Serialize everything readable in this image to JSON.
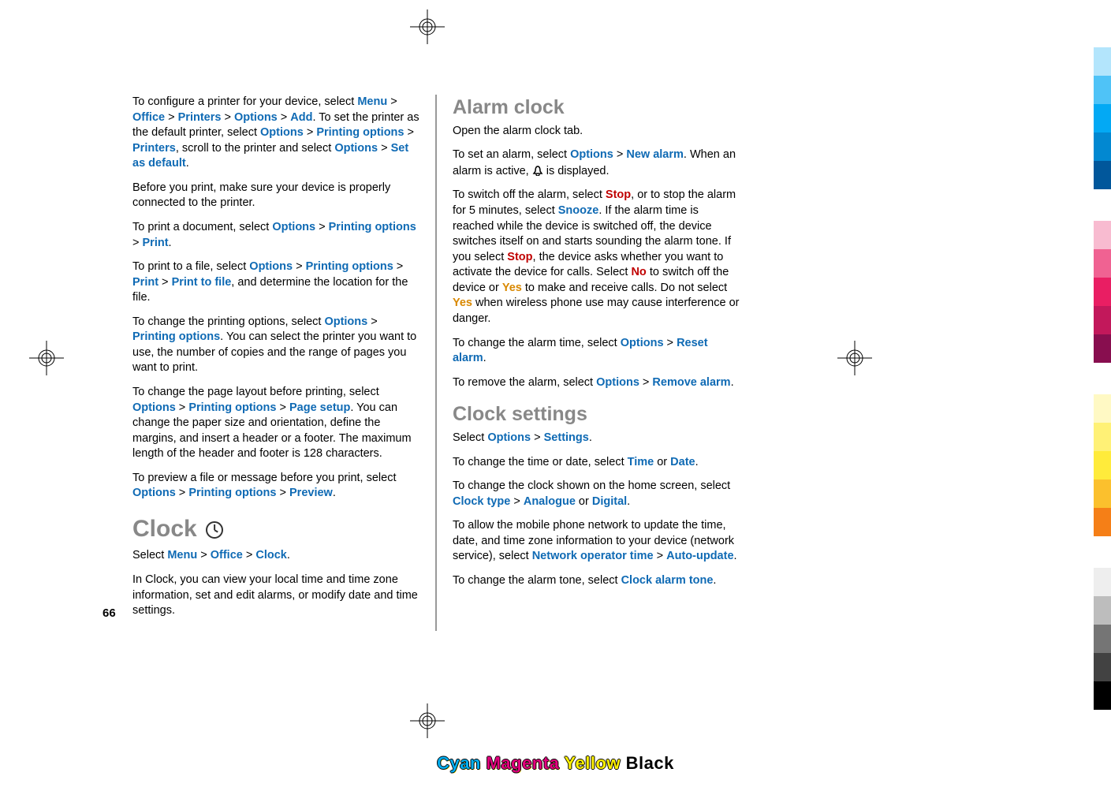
{
  "page_number": "66",
  "left_column": {
    "p1": {
      "t1": "To configure a printer for your device, select ",
      "menu": "Menu",
      "gt1": " > ",
      "office": "Office",
      "gt2": " > ",
      "printers": "Printers",
      "gt3": " > ",
      "options": "Options",
      "gt4": " > ",
      "add": "Add",
      "t2": ". To set the printer as the default printer, select ",
      "options2": "Options",
      "gt5": " > ",
      "printopt": "Printing options",
      "gt6": " > ",
      "printers2": "Printers",
      "t3": ", scroll to the printer and select ",
      "options3": "Options",
      "gt7": " > ",
      "setdef": "Set as default",
      "t4": "."
    },
    "p2": "Before you print, make sure your device is properly connected to the printer.",
    "p3": {
      "t1": "To print a document, select ",
      "options": "Options",
      "gt1": " > ",
      "printopt": "Printing options",
      "gt2": " > ",
      "print": "Print",
      "t2": "."
    },
    "p4": {
      "t1": "To print to a file, select ",
      "options": "Options",
      "gt1": " > ",
      "printopt": "Printing options",
      "gt2": " > ",
      "print": "Print",
      "gt3": " > ",
      "printfile": "Print to file",
      "t2": ", and determine the location for the file."
    },
    "p5": {
      "t1": "To change the printing options, select ",
      "options": "Options",
      "gt1": " > ",
      "printopt": "Printing options",
      "t2": ". You can select the printer you want to use, the number of copies and the range of pages you want to print."
    },
    "p6": {
      "t1": "To change the page layout before printing, select ",
      "options": "Options",
      "gt1": " > ",
      "printopt": "Printing options",
      "gt2": " > ",
      "pagesetup": "Page setup",
      "t2": ". You can change the paper size and orientation, define the margins, and insert a header or a footer. The maximum length of the header and footer is 128 characters."
    },
    "p7": {
      "t1": "To preview a file or message before you print, select ",
      "options": "Options",
      "gt1": " > ",
      "printopt": "Printing options",
      "gt2": " > ",
      "preview": "Preview",
      "t2": "."
    },
    "h_clock": "Clock",
    "p8": {
      "t1": "Select ",
      "menu": "Menu",
      "gt1": " > ",
      "office": "Office",
      "gt2": " > ",
      "clock": "Clock",
      "t2": "."
    },
    "p9": "In Clock, you can view your local time and time zone information, set and edit alarms, or modify date and time settings."
  },
  "right_column": {
    "h_alarm": "Alarm clock",
    "p1": "Open the alarm clock tab.",
    "p2": {
      "t1": "To set an alarm, select ",
      "options": "Options",
      "gt1": " > ",
      "newalarm": "New alarm",
      "t2": ". When an alarm is active, ",
      "t3": " is displayed."
    },
    "p3": {
      "t1": "To switch off the alarm, select ",
      "stop": "Stop",
      "t2": ", or to stop the alarm for 5 minutes, select ",
      "snooze": "Snooze",
      "t3": ". If the alarm time is reached while the device is switched off, the device switches itself on and starts sounding the alarm tone. If you select ",
      "stop2": "Stop",
      "t4": ", the device asks whether you want to activate the device for calls. Select ",
      "no": "No",
      "t5": " to switch off the device or ",
      "yes": "Yes",
      "t6": " to make and receive calls. Do not select ",
      "yes2": "Yes",
      "t7": " when wireless phone use may cause interference or danger."
    },
    "p4": {
      "t1": "To change the alarm time, select ",
      "options": "Options",
      "gt1": " > ",
      "reset": "Reset alarm",
      "t2": "."
    },
    "p5": {
      "t1": "To remove the alarm, select ",
      "options": "Options",
      "gt1": " > ",
      "remove": "Remove alarm",
      "t2": "."
    },
    "h_clockset": "Clock settings",
    "p6": {
      "t1": "Select ",
      "options": "Options",
      "gt1": " > ",
      "settings": "Settings",
      "t2": "."
    },
    "p7": {
      "t1": "To change the time or date, select ",
      "time": "Time",
      "t2": " or ",
      "date": "Date",
      "t3": "."
    },
    "p8": {
      "t1": "To change the clock shown on the home screen, select ",
      "ctype": "Clock type",
      "gt1": " > ",
      "analogue": "Analogue",
      "t2": " or ",
      "digital": "Digital",
      "t3": "."
    },
    "p9": {
      "t1": "To allow the mobile phone network to update the time, date, and time zone information to your device (network service), select ",
      "netop": "Network operator time",
      "gt1": " > ",
      "auto": "Auto-update",
      "t2": "."
    },
    "p10": {
      "t1": "To change the alarm tone, select ",
      "cat": "Clock alarm tone",
      "t2": "."
    }
  },
  "footer": {
    "cyan": "Cyan",
    "magenta": "Magenta",
    "yellow": "Yellow",
    "black": "Black"
  }
}
